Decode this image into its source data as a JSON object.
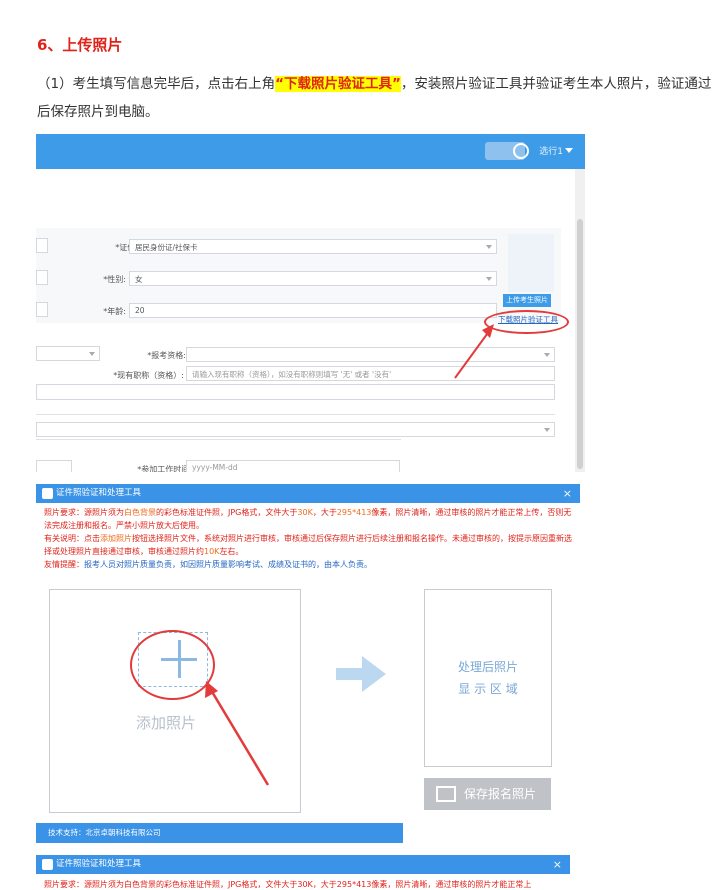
{
  "heading": "6、上传照片",
  "paragraph": {
    "before": "（1）考生填写信息完毕后，点击右上角",
    "highlight": "“下载照片验证工具”",
    "after": "，安装照片验证工具并验证考生本人照片，验证通过后保存照片到电脑。"
  },
  "screenshot1": {
    "user_name": "选行1",
    "fields": {
      "id_type_label": "*证件类型:",
      "id_type_value": "居民身份证/社保卡",
      "gender_label": "*性别:",
      "gender_value": "女",
      "age_label": "*年龄:",
      "age_value": "20",
      "exam_qual_label": "*报考资格:",
      "title_label": "*现有职称（资格）:",
      "title_placeholder": "请输入现有职称（资格），如没有职称则填写 '无' 或者 '没有'",
      "work_time_label": "*参加工作时间:",
      "work_time_placeholder": "yyyy-MM-dd"
    },
    "upload_button": "上传考生照片",
    "download_link": "下载照片验证工具"
  },
  "dialog": {
    "title": "证件照验证和处理工具",
    "close": "×",
    "note1_label": "照片要求：",
    "note1_a": "源照片须为",
    "note1_white": "白色背景",
    "note1_b": "的彩色标准证件照，JPG格式，文件大于",
    "note1_30k": "30K",
    "note1_c": "，大于",
    "note1_size": "295*413",
    "note1_d": "像素，照片清晰，通过审核的照片才能正常上传，否则无法完成注册和报名。严禁小照片放大后使用。",
    "note2_label": "有关说明：",
    "note2_a": "点击",
    "note2_add": "添加照片",
    "note2_b": "按钮选择照片文件，系统对照片进行审核，审核通过后保存照片进行后续注册和报名操作。未通过审核的，按提示原因重新选择或处理照片直接通过审核，审核通过照片约",
    "note2_size": "10K",
    "note2_c": "左右。",
    "note3_label": "友情提醒：",
    "note3_text": "报考人员对照片质量负责，如因照片质量影响考试、成绩及证书的，由本人负责。",
    "add_photo": "添加照片",
    "processed_line1": "处理后照片",
    "processed_line2": "显 示 区 域",
    "save_button": "保存报名照片",
    "footer": "技术支持：北京卓朝科技有限公司"
  },
  "dialog2": {
    "title": "证件照验证和处理工具",
    "close": "×",
    "note": "照片要求：源照片须为白色背景的彩色标准证件照，JPG格式，文件大于30K，大于295*413像素，照片清晰，通过审核的照片才能正常上"
  },
  "colors": {
    "accent_red": "#e0231a",
    "highlight_yellow": "#ffff00",
    "dialog_blue": "#3a93e6",
    "annotation_red": "#e33a3a"
  }
}
